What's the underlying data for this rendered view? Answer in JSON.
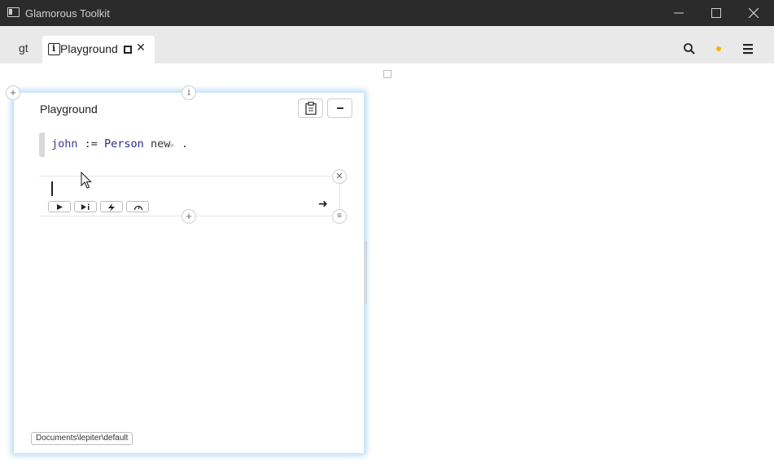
{
  "window": {
    "title": "Glamorous Toolkit",
    "controls": {
      "minimize": "minimize-icon",
      "maximize": "maximize-icon",
      "close": "close-icon"
    }
  },
  "tabs": [
    {
      "label": "gt"
    },
    {
      "label": "Playground",
      "icon": "inspector-icon"
    }
  ],
  "toolbar": {
    "search_icon": "search-icon",
    "status_dot_color": "#f5b800",
    "menu_icon": "hamburger-icon"
  },
  "playground": {
    "title": "Playground",
    "snippets": [
      {
        "tokens": [
          "john",
          " := ",
          "Person",
          " new",
          "▶",
          " ."
        ]
      },
      {
        "value": "",
        "buttons": [
          "run",
          "debug",
          "profile",
          "performance"
        ]
      }
    ],
    "database_path": "Documents\\lepiter\\default"
  },
  "colors": {
    "accent": "#a9d3fb",
    "pane_glow": "#b9d9f7",
    "titlebar": "#2b2b2b"
  }
}
